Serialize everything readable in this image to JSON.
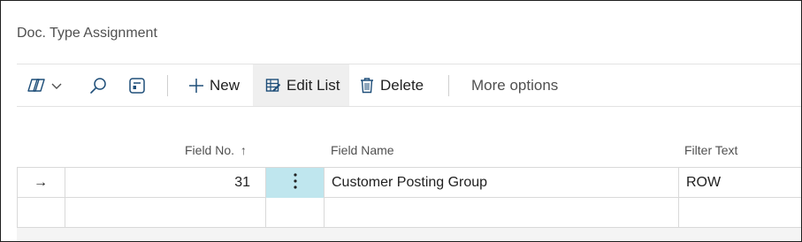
{
  "page": {
    "title": "Doc. Type Assignment"
  },
  "toolbar": {
    "icons": [
      "filter-pane-icon",
      "chevron-down-icon",
      "search-icon",
      "filter-icon"
    ],
    "new_label": "New",
    "edit_list_label": "Edit List",
    "delete_label": "Delete",
    "more_options_label": "More options"
  },
  "grid": {
    "columns": {
      "field_no": "Field No.",
      "sort_indicator": "↑",
      "field_name": "Field Name",
      "filter_text": "Filter Text"
    },
    "rows": [
      {
        "indicator": "→",
        "field_no": "31",
        "field_name": "Customer Posting Group",
        "filter_text": "ROW"
      }
    ]
  },
  "colors": {
    "selected_cell": "#bfe6ee",
    "active_button_bg": "#efefef",
    "grid_lines": "#d9d9d9",
    "icon_stroke": "#1e4e79"
  }
}
